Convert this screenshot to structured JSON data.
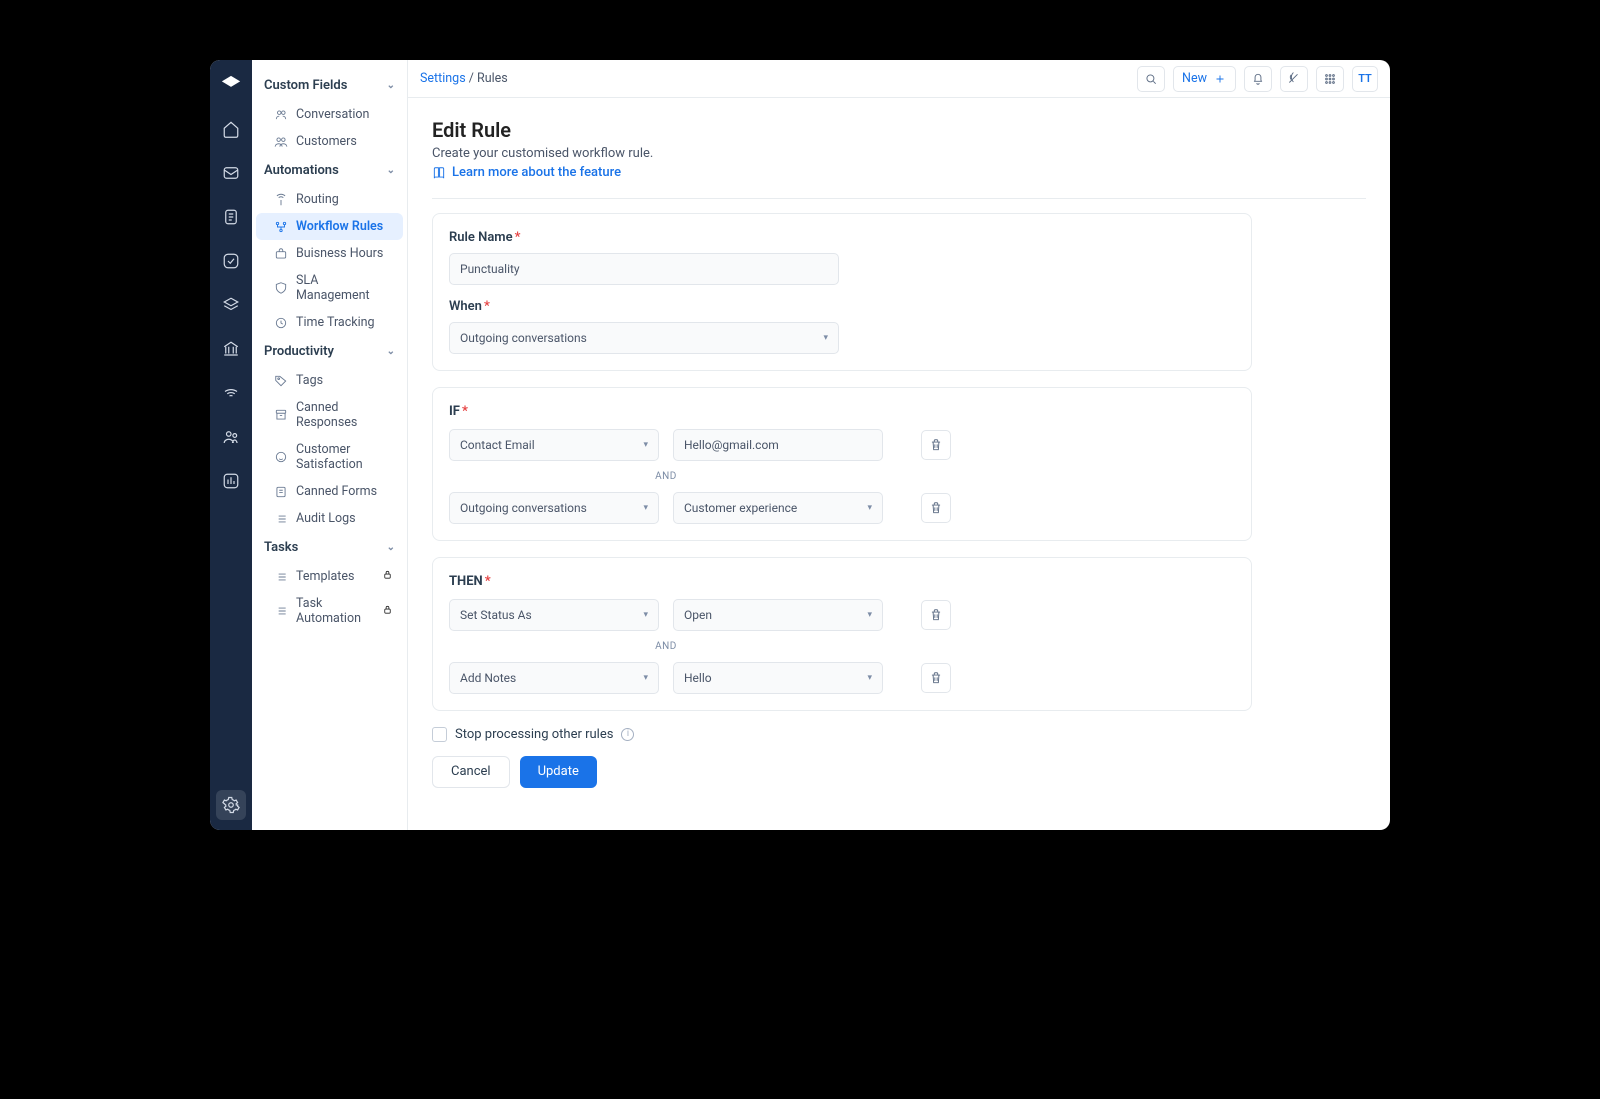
{
  "breadcrumb": {
    "parent": "Settings",
    "current": "Rules"
  },
  "topbar": {
    "new_label": "New",
    "avatar_initials": "TT"
  },
  "sidebar": {
    "groups": [
      {
        "title": "Custom Fields",
        "items": [
          {
            "label": "Conversation",
            "icon": "people-icon"
          },
          {
            "label": "Customers",
            "icon": "users-icon"
          }
        ]
      },
      {
        "title": "Automations",
        "items": [
          {
            "label": "Routing",
            "icon": "antenna-icon"
          },
          {
            "label": "Workflow Rules",
            "icon": "flow-icon",
            "active": true
          },
          {
            "label": "Buisness Hours",
            "icon": "briefcase-icon"
          },
          {
            "label": "SLA Management",
            "icon": "shield-icon"
          },
          {
            "label": "Time Tracking",
            "icon": "clock-icon"
          }
        ]
      },
      {
        "title": "Productivity",
        "items": [
          {
            "label": "Tags",
            "icon": "tag-icon"
          },
          {
            "label": "Canned Responses",
            "icon": "archive-icon"
          },
          {
            "label": "Customer Satisfaction",
            "icon": "smile-icon"
          },
          {
            "label": "Canned Forms",
            "icon": "form-icon"
          },
          {
            "label": "Audit Logs",
            "icon": "list-icon"
          }
        ]
      },
      {
        "title": "Tasks",
        "items": [
          {
            "label": "Templates",
            "icon": "list-icon",
            "locked": true
          },
          {
            "label": "Task Automation",
            "icon": "list-icon",
            "locked": true
          }
        ]
      }
    ]
  },
  "page": {
    "title": "Edit Rule",
    "subtitle": "Create your customised workflow rule.",
    "learn_more": "Learn more about the feature"
  },
  "form": {
    "name_label": "Rule Name",
    "name_value": "Punctuality",
    "when_label": "When",
    "when_value": "Outgoing conversations",
    "if_label": "IF",
    "then_label": "THEN",
    "and_label": "AND",
    "if_rows": [
      {
        "field": "Contact Email",
        "value": "Hello@gmail.com"
      },
      {
        "field": "Outgoing conversations",
        "value": "Customer experience"
      }
    ],
    "then_rows": [
      {
        "action": "Set Status As",
        "value": "Open"
      },
      {
        "action": "Add Notes",
        "value": "Hello"
      }
    ],
    "stop_label": "Stop processing other rules",
    "cancel_label": "Cancel",
    "update_label": "Update"
  }
}
